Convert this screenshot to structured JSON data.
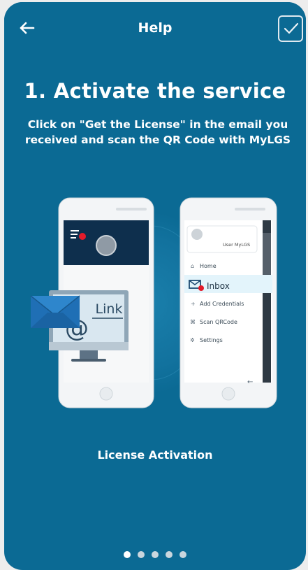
{
  "header": {
    "title": "Help",
    "back_icon": "arrow-left-icon",
    "confirm_icon": "checkbox-check-icon"
  },
  "step": {
    "heading": "1. Activate the service",
    "instruction": "Click on \"Get the License\" in the email you received and scan the QR Code with MyLGS"
  },
  "illustration": {
    "link_label": "Link",
    "profile_label": "User MyLGS",
    "menu": {
      "home": "Home",
      "inbox": "Inbox",
      "add_credentials": "Add Credentials",
      "scan_qrcode": "Scan QRCode",
      "settings": "Settings"
    }
  },
  "caption": "License Activation",
  "pagination": {
    "total": 5,
    "current": 1
  },
  "colors": {
    "background": "#0b6a94",
    "phone_header": "#0e2f4d",
    "accent_red": "#e31b2a",
    "highlight": "#e3f4fb"
  }
}
